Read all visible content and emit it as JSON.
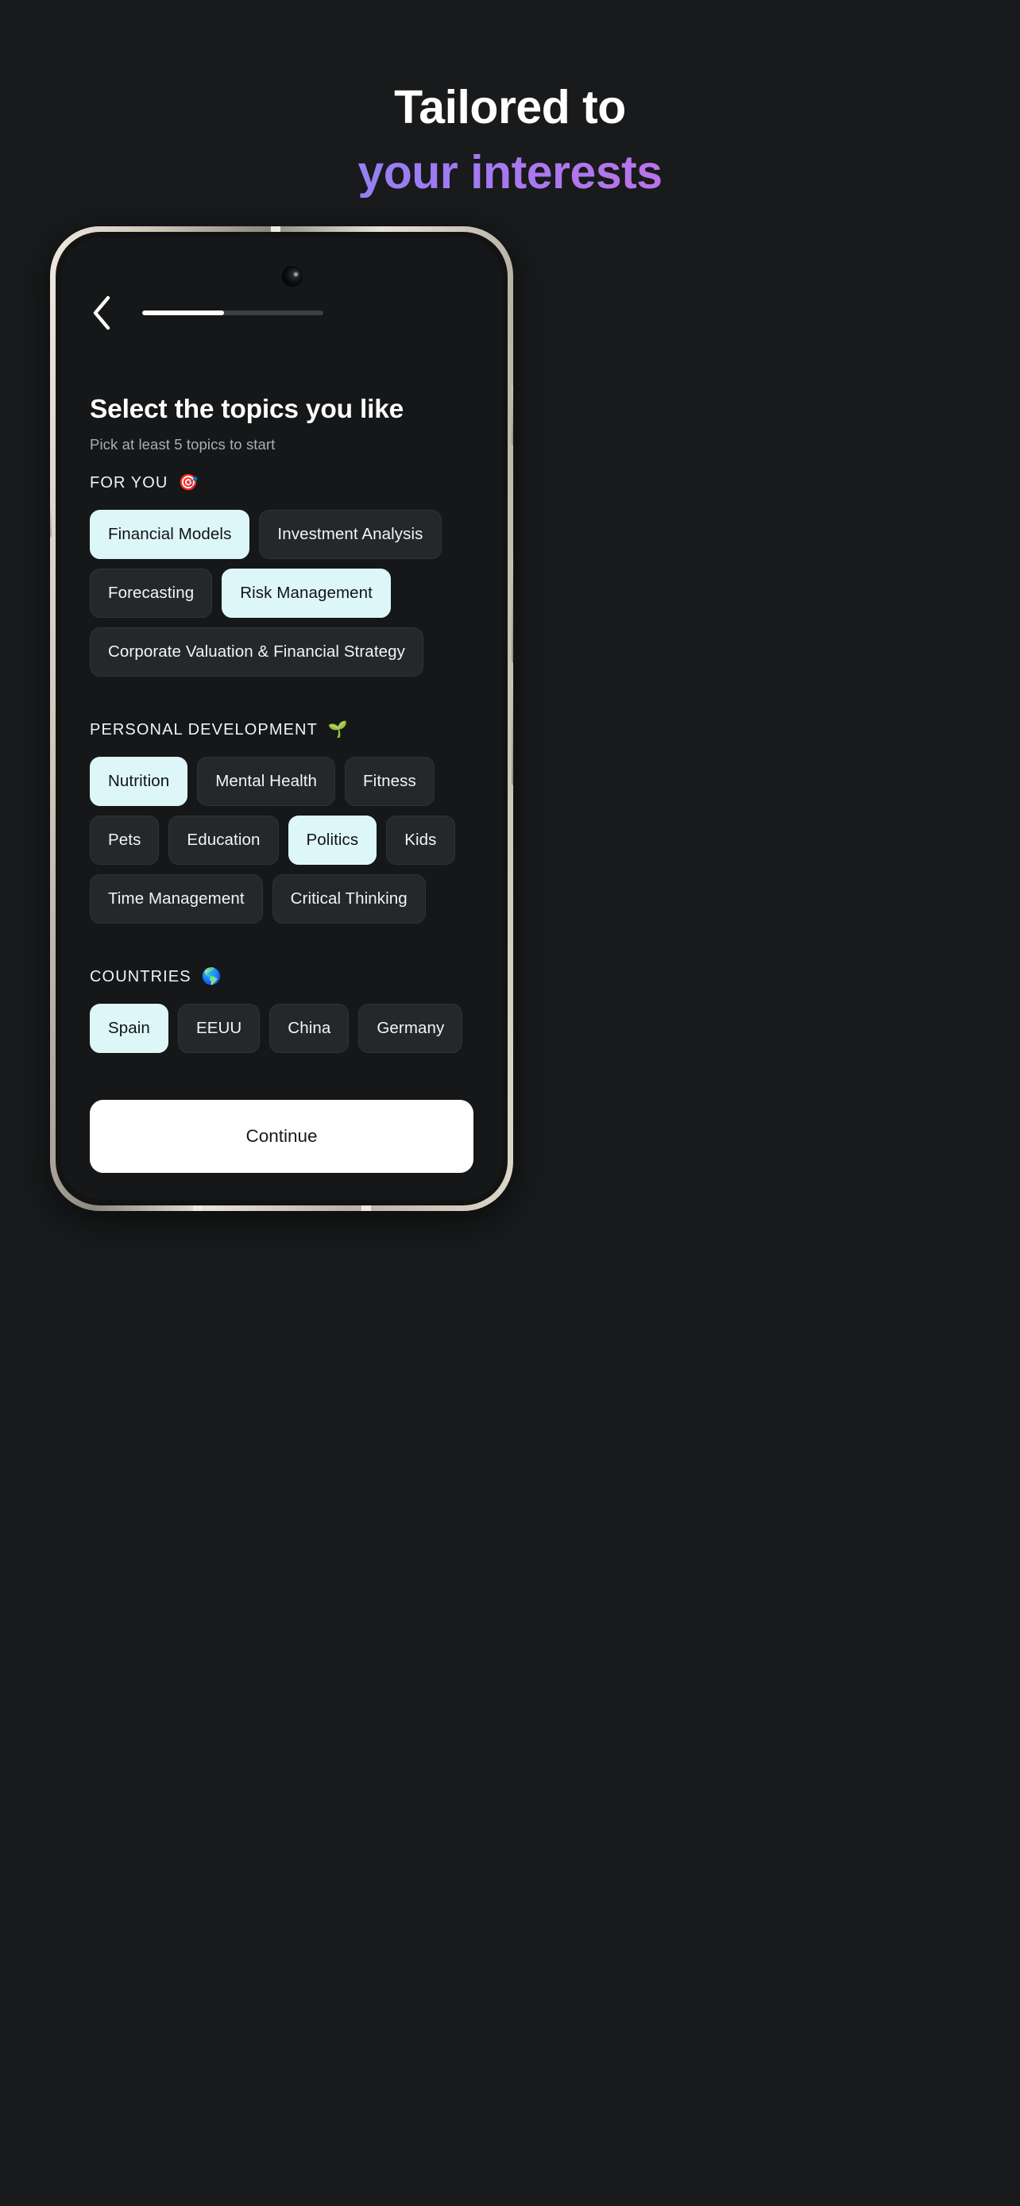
{
  "hero": {
    "line1": "Tailored to",
    "line2": "your interests",
    "gradient_start": "#6f9cf0",
    "gradient_mid": "#9d7bf2",
    "gradient_end": "#e06fc4"
  },
  "phone": {
    "screen_bg": "#151718",
    "bezel_color": "#e4dfd2"
  },
  "screen": {
    "back_icon": "chevron-left-icon",
    "progress_percent": 45,
    "title": "Select the topics you like",
    "subtitle": "Pick at least 5 topics to start",
    "selected_chip_bg": "#ddf7f9",
    "unselected_chip_bg": "#25282a",
    "sections": [
      {
        "label": "FOR YOU",
        "emoji": "🎯",
        "emoji_name": "target-emoji",
        "chips": [
          {
            "label": "Financial Models",
            "selected": true
          },
          {
            "label": "Investment Analysis",
            "selected": false
          },
          {
            "label": "Forecasting",
            "selected": false
          },
          {
            "label": "Risk Management",
            "selected": true
          },
          {
            "label": "Corporate Valuation & Financial Strategy",
            "selected": false
          }
        ]
      },
      {
        "label": "PERSONAL DEVELOPMENT",
        "emoji": "🌱",
        "emoji_name": "seedling-emoji",
        "chips": [
          {
            "label": "Nutrition",
            "selected": true
          },
          {
            "label": "Mental Health",
            "selected": false
          },
          {
            "label": "Fitness",
            "selected": false
          },
          {
            "label": "Pets",
            "selected": false
          },
          {
            "label": "Education",
            "selected": false
          },
          {
            "label": "Politics",
            "selected": true
          },
          {
            "label": "Kids",
            "selected": false
          },
          {
            "label": "Time Management",
            "selected": false
          },
          {
            "label": "Critical Thinking",
            "selected": false
          }
        ]
      },
      {
        "label": "COUNTRIES",
        "emoji": "🌎",
        "emoji_name": "globe-americas-emoji",
        "chips": [
          {
            "label": "Spain",
            "selected": true
          },
          {
            "label": "EEUU",
            "selected": false
          },
          {
            "label": "China",
            "selected": false
          },
          {
            "label": "Germany",
            "selected": false
          }
        ]
      }
    ],
    "continue_label": "Continue"
  }
}
